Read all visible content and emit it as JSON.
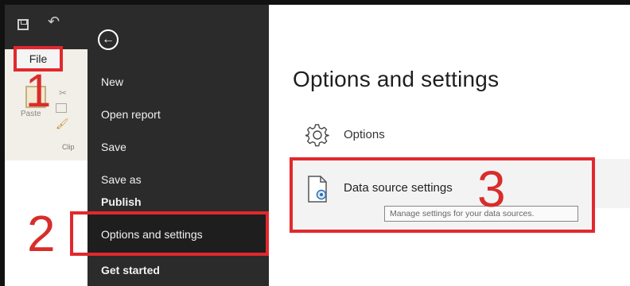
{
  "quick_access": {
    "save_icon": "save-icon",
    "undo_icon": "undo-icon"
  },
  "ribbon": {
    "file_tab": "File",
    "paste_label": "Paste",
    "clipboard_label": "Clip"
  },
  "steps": {
    "one": "1",
    "two": "2",
    "three": "3"
  },
  "menu": {
    "back_icon": "arrow-left-circle-icon",
    "items": [
      {
        "label": "New"
      },
      {
        "label": "Open report"
      },
      {
        "label": "Save"
      },
      {
        "label": "Save as"
      },
      {
        "label": "Publish"
      },
      {
        "label": "Options and settings"
      },
      {
        "label": "Get started"
      }
    ]
  },
  "panel": {
    "title": "Options and settings",
    "options_label": "Options",
    "data_source_label": "Data source settings",
    "tooltip": "Manage settings for your data sources."
  },
  "colors": {
    "annotation_red": "#e2282d",
    "menu_bg": "#2b2b2b",
    "panel_bg": "#ffffff"
  }
}
